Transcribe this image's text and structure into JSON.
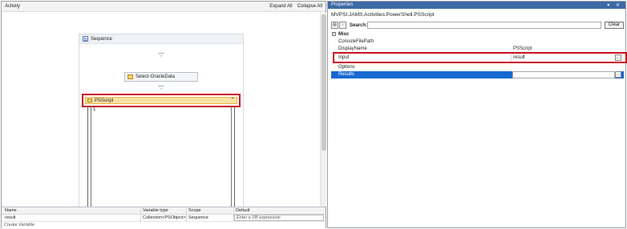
{
  "designer": {
    "title": "Activity",
    "expand_all": "Expand All",
    "collapse_all": "Collapse All",
    "sequence_label": "Sequence",
    "activity1_label": "Select-OracleData",
    "activity2_label": "PSScript",
    "collapse_glyph": "⌃",
    "line_number": "1"
  },
  "variables": {
    "headers": [
      "Name",
      "Variable type",
      "Scope",
      "Default"
    ],
    "row": {
      "name": "result",
      "type": "Collection<PSObject>",
      "scope": "Sequence",
      "default_placeholder": "Enter a VB expression"
    },
    "create_label": "Create Variable"
  },
  "properties": {
    "title": "Properties",
    "window_buttons": "▾ ✕",
    "type_name": "MVPSI.JAMS.Activities.PowerShell.PSScript",
    "search_label": "Search:",
    "clear_label": "Clear",
    "category": "Misc",
    "rows": [
      {
        "name": "ConsoleFilePath",
        "value": ""
      },
      {
        "name": "DisplayName",
        "value": "PSScript"
      },
      {
        "name": "Input",
        "value": "result"
      },
      {
        "name": "Options",
        "value": ""
      },
      {
        "name": "Results",
        "value": ""
      }
    ],
    "ellipsis": "..."
  },
  "colors": {
    "highlight": "#c8141e",
    "selection": "#1669d1",
    "titlebar": "#3d6aa6"
  }
}
